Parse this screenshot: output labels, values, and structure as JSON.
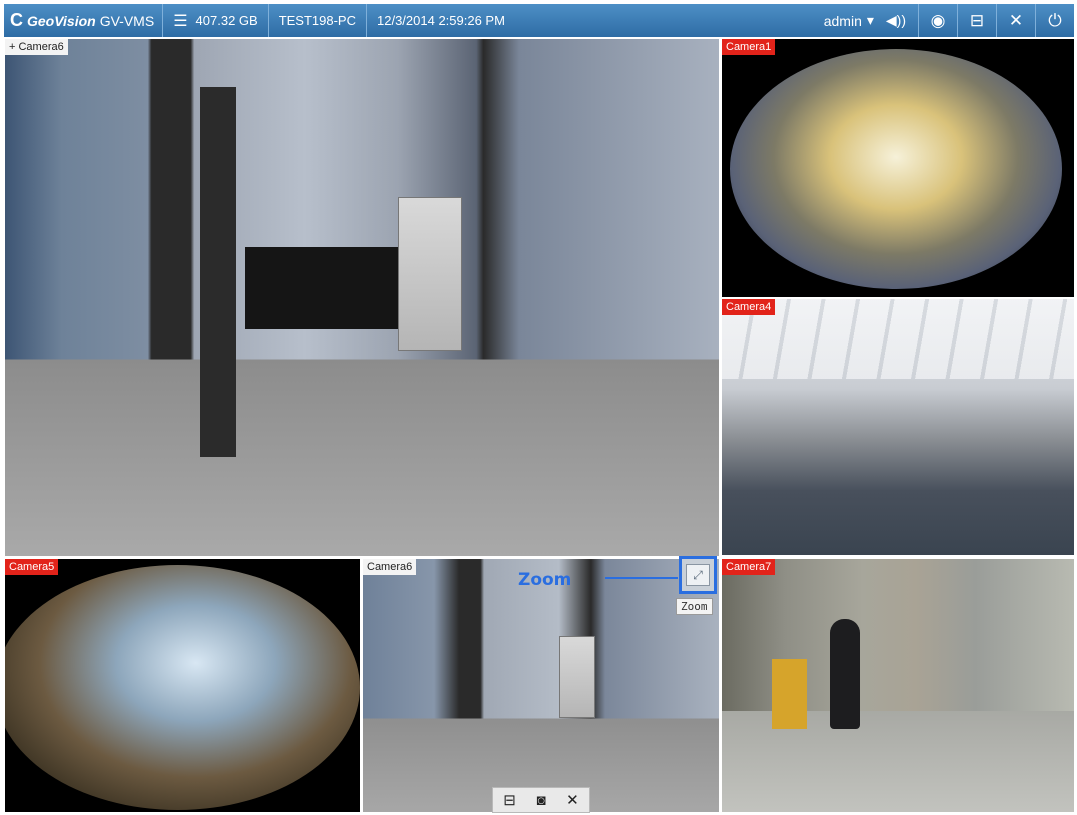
{
  "topbar": {
    "logo_mark": "C",
    "logo_text": "GeoVision",
    "product": "GV-VMS",
    "storage": "407.32 GB",
    "pc_name": "TEST198-PC",
    "datetime": "12/3/2014 2:59:26 PM",
    "user": "admin",
    "user_caret": "▾",
    "volume_icon": "◀))",
    "buttons": [
      {
        "name": "eye-icon",
        "glyph": "◉"
      },
      {
        "name": "layout-icon",
        "glyph": "⊟"
      },
      {
        "name": "tools-icon",
        "glyph": "✕"
      },
      {
        "name": "power-icon",
        "glyph": "⏻"
      }
    ],
    "colors": {
      "bar": "#3d7fbd",
      "accent": "#2a6ee0",
      "camera_tag": "#e2231a"
    }
  },
  "panes": {
    "main": {
      "label": "+ Camera6"
    },
    "cam1": {
      "label": "Camera1"
    },
    "cam4": {
      "label": "Camera4"
    },
    "cam5": {
      "label": "Camera5"
    },
    "cam6": {
      "label": "Camera6"
    },
    "cam7": {
      "label": "Camera7"
    }
  },
  "zoom": {
    "callout": "Zoom",
    "tooltip": "Zoom",
    "icon": "zoom-icon"
  },
  "pane_toolbar": {
    "icons": [
      "layout-icon",
      "camera-icon",
      "tools-icon"
    ]
  }
}
